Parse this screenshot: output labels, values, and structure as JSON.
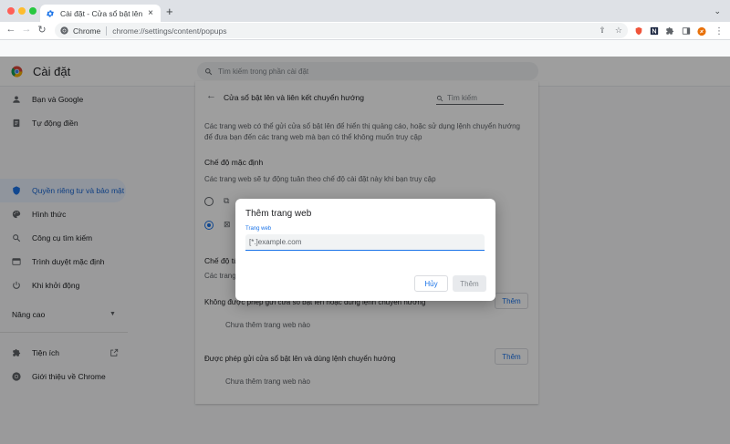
{
  "browser": {
    "tab_title": "Cài đặt - Cửa sổ bật lên và liên",
    "tab_close": "×",
    "new_tab": "+",
    "tab_menu": "⌄",
    "omnibox_origin": "Chrome",
    "url": "chrome://settings/content/popups"
  },
  "header": {
    "title": "Cài đặt",
    "search_placeholder": "Tìm kiếm trong phần cài đặt"
  },
  "sidebar": {
    "items": [
      {
        "label": "Bạn và Google",
        "icon": "person-icon"
      },
      {
        "label": "Tự động điền",
        "icon": "autofill-icon"
      },
      {
        "label": "Quyền riêng tư và bảo mật",
        "icon": "shield-icon",
        "active": true
      },
      {
        "label": "Hình thức",
        "icon": "palette-icon"
      },
      {
        "label": "Công cụ tìm kiếm",
        "icon": "search-icon"
      },
      {
        "label": "Trình duyệt mặc định",
        "icon": "browser-icon"
      },
      {
        "label": "Khi khởi động",
        "icon": "power-icon"
      }
    ],
    "advanced": "Nâng cao",
    "extensions": "Tiện ích",
    "about": "Giới thiệu về Chrome"
  },
  "content": {
    "title": "Cửa sổ bật lên và liên kết chuyển hướng",
    "search_placeholder": "Tìm kiếm",
    "description": "Các trang web có thể gửi cửa sổ bật lên để hiển thị quảng cáo, hoặc sử dụng lệnh chuyển hướng để đưa bạn đến các trang web mà bạn có thể không muốn truy cập",
    "default_heading": "Chế độ mặc định",
    "default_sub": "Các trang web sẽ tự động tuân theo chế độ cài đặt này khi bạn truy cập",
    "custom_heading": "Chế độ tù",
    "custom_sub": "Các trang",
    "blocked_label": "Không được phép gửi cửa sổ bật lên hoặc dùng lệnh chuyển hướng",
    "allowed_label": "Được phép gửi cửa sổ bật lên và dùng lệnh chuyển hướng",
    "add_label": "Thêm",
    "empty_label": "Chưa thêm trang web nào"
  },
  "dialog": {
    "title": "Thêm trang web",
    "field_label": "Trang web",
    "placeholder": "[*.]example.com",
    "cancel": "Hủy",
    "ok": "Thêm"
  },
  "colors": {
    "accent": "#1a73e8",
    "active_bg": "#e8f0fe"
  }
}
